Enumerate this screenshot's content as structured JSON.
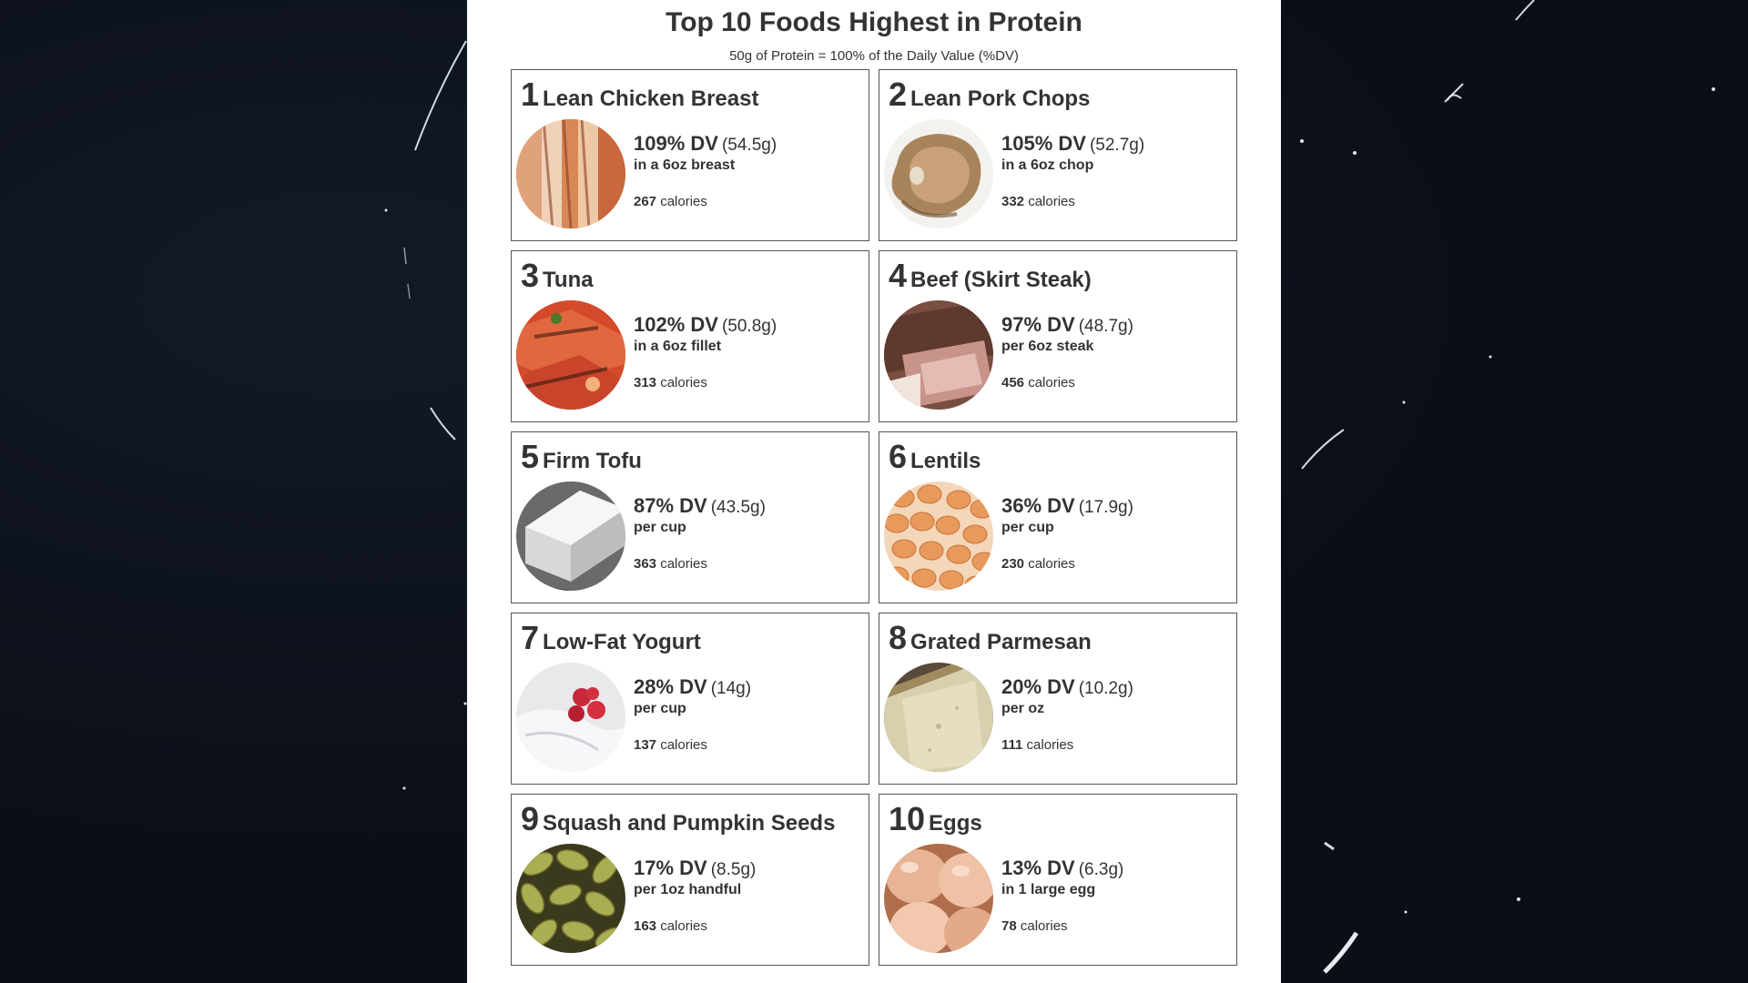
{
  "header": {
    "title": "Top 10 Foods Highest in Protein",
    "subtitle": "50g of Protein = 100% of the Daily Value (%DV)"
  },
  "foods": [
    {
      "rank": "1",
      "name": "Lean Chicken Breast",
      "dv": "109% DV",
      "grams": "(54.5g)",
      "serving": "in a 6oz breast",
      "calories": "267",
      "calories_label": "calories",
      "icon": "chicken-breast-image"
    },
    {
      "rank": "2",
      "name": "Lean Pork Chops",
      "dv": "105% DV",
      "grams": "(52.7g)",
      "serving": "in a 6oz chop",
      "calories": "332",
      "calories_label": "calories",
      "icon": "pork-chop-image"
    },
    {
      "rank": "3",
      "name": "Tuna",
      "dv": "102% DV",
      "grams": "(50.8g)",
      "serving": "in a 6oz fillet",
      "calories": "313",
      "calories_label": "calories",
      "icon": "tuna-image"
    },
    {
      "rank": "4",
      "name": "Beef (Skirt Steak)",
      "dv": "97% DV",
      "grams": "(48.7g)",
      "serving": "per 6oz steak",
      "calories": "456",
      "calories_label": "calories",
      "icon": "steak-image"
    },
    {
      "rank": "5",
      "name": "Firm Tofu",
      "dv": "87% DV",
      "grams": "(43.5g)",
      "serving": "per cup",
      "calories": "363",
      "calories_label": "calories",
      "icon": "tofu-image"
    },
    {
      "rank": "6",
      "name": "Lentils",
      "dv": "36% DV",
      "grams": "(17.9g)",
      "serving": "per cup",
      "calories": "230",
      "calories_label": "calories",
      "icon": "lentils-image"
    },
    {
      "rank": "7",
      "name": "Low-Fat Yogurt",
      "dv": "28% DV",
      "grams": "(14g)",
      "serving": "per cup",
      "calories": "137",
      "calories_label": "calories",
      "icon": "yogurt-image"
    },
    {
      "rank": "8",
      "name": "Grated Parmesan",
      "dv": "20% DV",
      "grams": "(10.2g)",
      "serving": "per oz",
      "calories": "111",
      "calories_label": "calories",
      "icon": "parmesan-image"
    },
    {
      "rank": "9",
      "name": "Squash and Pumpkin Seeds",
      "dv": "17% DV",
      "grams": "(8.5g)",
      "serving": "per 1oz handful",
      "calories": "163",
      "calories_label": "calories",
      "icon": "pumpkin-seeds-image"
    },
    {
      "rank": "10",
      "name": "Eggs",
      "dv": "13% DV",
      "grams": "(6.3g)",
      "serving": "in 1 large egg",
      "calories": "78",
      "calories_label": "calories",
      "icon": "eggs-image"
    }
  ],
  "colors": {
    "background": "#0c1019",
    "page": "#ffffff",
    "text": "#333333",
    "card_border": "#555555"
  }
}
